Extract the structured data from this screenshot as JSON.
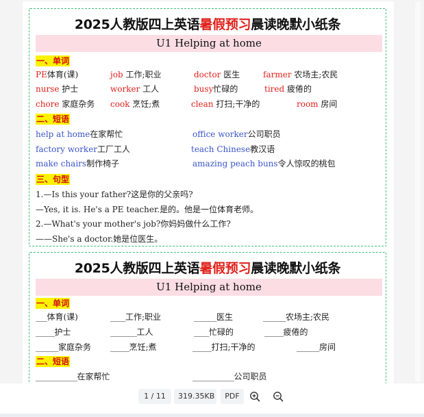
{
  "card1": {
    "title_pre": "2025人教版四上英语",
    "title_hl": "暑假预习",
    "title_post": "晨读晚默小纸条",
    "unit": "U1 Helping at home",
    "sections": [
      "一、单词",
      "二、短语",
      "三、句型"
    ],
    "words": [
      [
        {
          "en": "PE",
          "zh": "体育(课)"
        },
        {
          "en": "job",
          "zh": " 工作;职业"
        },
        {
          "en": "doctor",
          "zh": " 医生"
        },
        {
          "en": "farmer",
          "zh": " 农场主;农民"
        }
      ],
      [
        {
          "en": "nurse",
          "zh": " 护士"
        },
        {
          "en": "worker",
          "zh": " 工人"
        },
        {
          "en": "busy",
          "zh": "忙碌的"
        },
        {
          "en": "tired",
          "zh": " 疲倦的"
        }
      ],
      [
        {
          "en": "chore",
          "zh": " 家庭杂务"
        },
        {
          "en": "cook",
          "zh": " 烹饪;煮"
        },
        {
          "en": "clean",
          "zh": " 打扫;干净的"
        },
        {
          "en": "room",
          "zh": " 房间"
        }
      ]
    ],
    "phrases": [
      [
        {
          "en": "help at home",
          "zh": "在家帮忙"
        },
        {
          "en": "office worker",
          "zh": "公司职员"
        }
      ],
      [
        {
          "en": "factory worker",
          "zh": "工厂工人"
        },
        {
          "en": "teach Chinese",
          "zh": "教汉语"
        }
      ],
      [
        {
          "en": "make chairs",
          "zh": "制作椅子"
        },
        {
          "en": "amazing peach buns",
          "zh": "令人惊叹的桃包"
        }
      ]
    ],
    "sentences": [
      "1.—Is this your father?这是你的父亲吗?",
      "—Yes, it is. He's a PE teacher.是的。他是一位体育老师。",
      "2.—What's your mother's job?你妈妈做什么工作?",
      "——She's a doctor.她是位医生。"
    ]
  },
  "card2": {
    "title_pre": "2025人教版四上英语",
    "title_hl": "暑假预习",
    "title_post": "晨读晚默小纸条",
    "unit": "U1 Helping at home",
    "sections": [
      "一、单词",
      "二、短语"
    ],
    "words": [
      [
        {
          "b": "___",
          "zh": "体育(课)"
        },
        {
          "b": "____",
          "zh": "工作;职业"
        },
        {
          "b": "______",
          "zh": "医生"
        },
        {
          "b": "______",
          "zh": "农场主;农民"
        }
      ],
      [
        {
          "b": "_____",
          "zh": "护士"
        },
        {
          "b": "_______",
          "zh": "工人"
        },
        {
          "b": "____",
          "zh": "忙碌的"
        },
        {
          "b": "_____",
          "zh": "疲倦的"
        }
      ],
      [
        {
          "b": "______",
          "zh": "家庭杂务"
        },
        {
          "b": "_____",
          "zh": "烹饪;煮"
        },
        {
          "b": "_____",
          "zh": "打扫;干净的"
        },
        {
          "b": "______",
          "zh": "房间"
        }
      ]
    ],
    "phrases": [
      [
        {
          "b": "___________",
          "zh": "在家帮忙"
        },
        {
          "b": "___________",
          "zh": "公司职员"
        }
      ]
    ]
  },
  "footer": {
    "page_indicator": "1 / 11",
    "file_size": "319.35KB",
    "file_type": "PDF",
    "zoom_in_icon": "zoom-in-icon",
    "zoom_out_icon": "zoom-out-icon"
  }
}
